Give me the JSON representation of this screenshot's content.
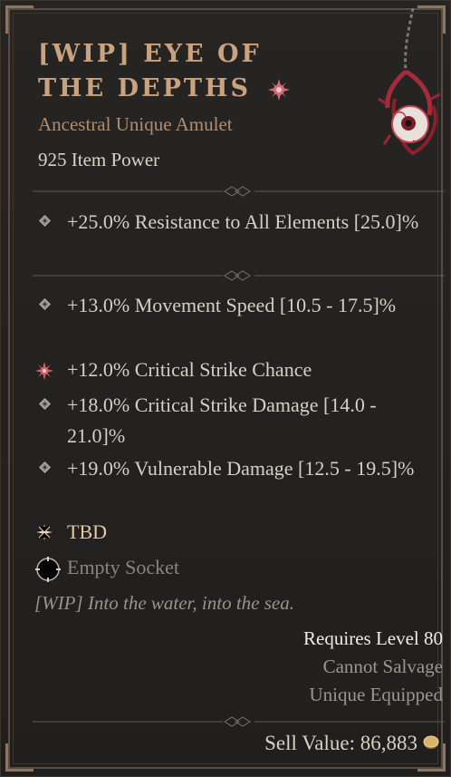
{
  "item": {
    "name": "[WIP] EYE OF THE DEPTHS",
    "type": "Ancestral Unique Amulet",
    "item_power": "925 Item Power",
    "implicit": "+25.0% Resistance to All Elements [25.0]%",
    "affixes": [
      "+13.0% Movement Speed [10.5 - 17.5]%",
      "+12.0% Critical Strike Chance",
      "+18.0% Critical Strike Damage [14.0 - 21.0]%",
      "+19.0% Vulnerable Damage [12.5 - 19.5]%"
    ],
    "unique_power": "TBD",
    "socket": "Empty Socket",
    "flavor_text": "[WIP] Into the water, into the sea.",
    "requirements": {
      "level": "Requires Level 80",
      "salvage": "Cannot Salvage",
      "equip": "Unique Equipped"
    },
    "sell_value": "Sell Value: 86,883"
  },
  "icons": {
    "unique": "unique-sigil-icon",
    "bullet": "diamond-bullet-icon",
    "legendary": "legendary-sigil-icon",
    "unique_power": "star-icon",
    "socket": "socket-icon",
    "gold": "gold-coin-icon"
  },
  "colors": {
    "title": "#c9a27f",
    "subtitle": "#b58c6a",
    "text": "#d6cfc5",
    "muted": "#9d968d",
    "legendary": "#d2636d"
  }
}
